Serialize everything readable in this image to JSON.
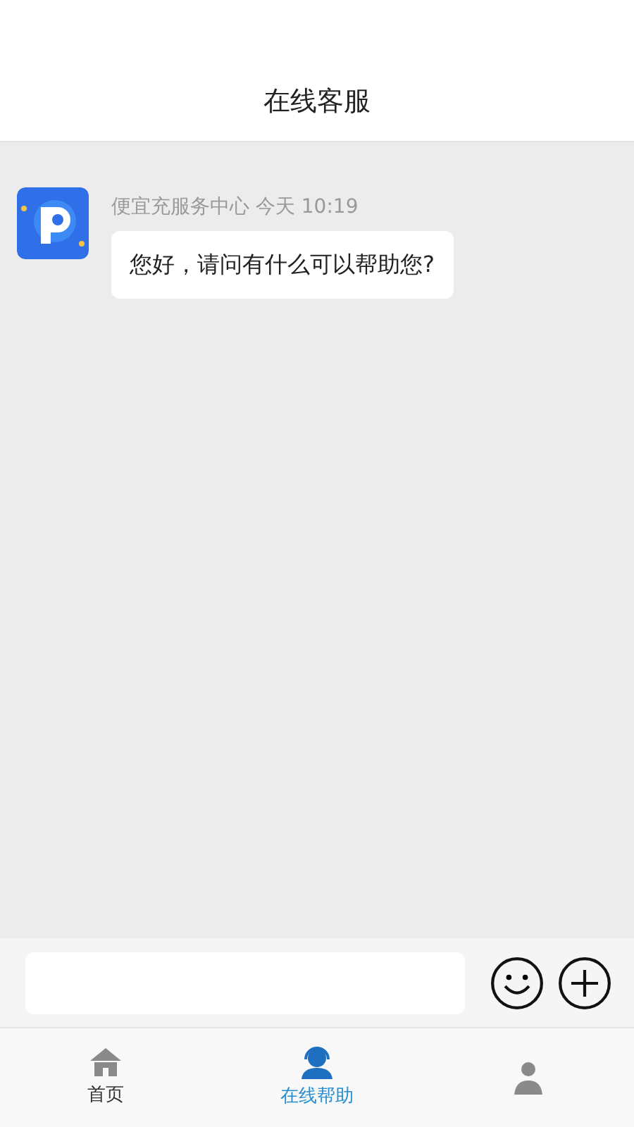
{
  "header": {
    "title": "在线客服"
  },
  "messages": [
    {
      "sender": "便宜充服务中心",
      "time": "今天 10:19",
      "text": "您好，请问有什么可以帮助您?"
    }
  ],
  "input_bar": {
    "buttons": [
      {
        "kind": "emoji"
      },
      {
        "kind": "plus"
      }
    ]
  },
  "tab_bar": [
    {
      "kind": "home",
      "label": "首页",
      "selected": false
    },
    {
      "kind": "support",
      "label": "在线帮助",
      "selected": true
    },
    {
      "kind": "person",
      "selected": false
    }
  ]
}
